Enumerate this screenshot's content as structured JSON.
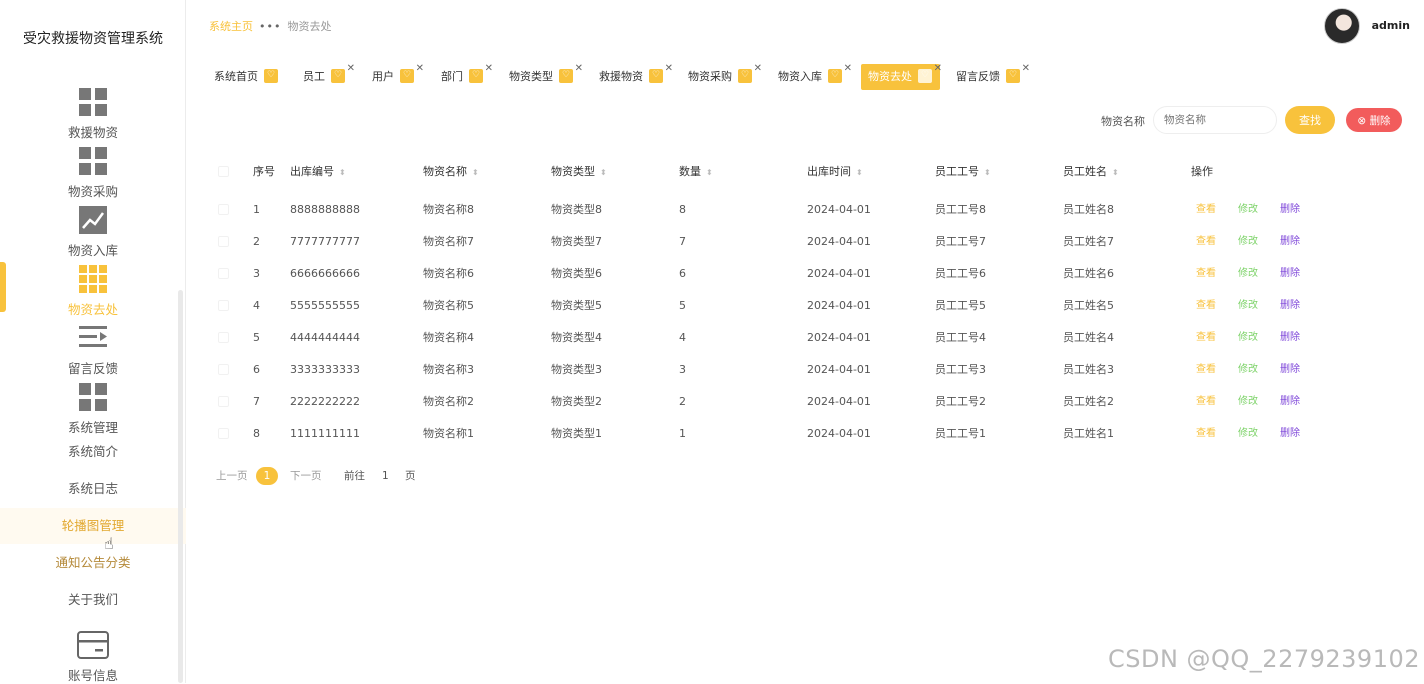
{
  "app": {
    "title": "受灾救援物资管理系统"
  },
  "sidebar": {
    "items": [
      {
        "label": "救援物资",
        "icon": "grid-icon"
      },
      {
        "label": "物资采购",
        "icon": "grid-icon"
      },
      {
        "label": "物资入库",
        "icon": "chart-icon"
      },
      {
        "label": "物资去处",
        "icon": "apps-icon"
      },
      {
        "label": "留言反馈",
        "icon": "list-icon"
      },
      {
        "label": "系统管理",
        "icon": "grid-icon"
      }
    ],
    "sub_items": [
      "系统简介",
      "系统日志",
      "轮播图管理",
      "通知公告分类",
      "关于我们"
    ],
    "account": {
      "label": "账号信息",
      "icon": "card-icon"
    }
  },
  "header": {
    "breadcrumb": {
      "home": "系统主页",
      "current": "物资去处"
    },
    "user": "admin"
  },
  "tabs": [
    "系统首页",
    "员工",
    "用户",
    "部门",
    "物资类型",
    "救援物资",
    "物资采购",
    "物资入库",
    "物资去处",
    "留言反馈"
  ],
  "search": {
    "label": "物资名称",
    "placeholder": "物资名称",
    "search_btn": "查找",
    "delete_btn": "删除"
  },
  "table": {
    "columns": [
      "序号",
      "出库编号",
      "物资名称",
      "物资类型",
      "数量",
      "出库时间",
      "员工工号",
      "员工姓名",
      "操作"
    ],
    "rows": [
      [
        "1",
        "8888888888",
        "物资名称8",
        "物资类型8",
        "8",
        "2024-04-01",
        "员工工号8",
        "员工姓名8"
      ],
      [
        "2",
        "7777777777",
        "物资名称7",
        "物资类型7",
        "7",
        "2024-04-01",
        "员工工号7",
        "员工姓名7"
      ],
      [
        "3",
        "6666666666",
        "物资名称6",
        "物资类型6",
        "6",
        "2024-04-01",
        "员工工号6",
        "员工姓名6"
      ],
      [
        "4",
        "5555555555",
        "物资名称5",
        "物资类型5",
        "5",
        "2024-04-01",
        "员工工号5",
        "员工姓名5"
      ],
      [
        "5",
        "4444444444",
        "物资名称4",
        "物资类型4",
        "4",
        "2024-04-01",
        "员工工号4",
        "员工姓名4"
      ],
      [
        "6",
        "3333333333",
        "物资名称3",
        "物资类型3",
        "3",
        "2024-04-01",
        "员工工号3",
        "员工姓名3"
      ],
      [
        "7",
        "2222222222",
        "物资名称2",
        "物资类型2",
        "2",
        "2024-04-01",
        "员工工号2",
        "员工姓名2"
      ],
      [
        "8",
        "1111111111",
        "物资名称1",
        "物资类型1",
        "1",
        "2024-04-01",
        "员工工号1",
        "员工姓名1"
      ]
    ],
    "actions": {
      "view": "查看",
      "edit": "修改",
      "delete": "删除"
    }
  },
  "pager": {
    "prev": "上一页",
    "current": "1",
    "next": "下一页",
    "goto": "前往",
    "page_input": "1",
    "page_suffix": "页"
  },
  "watermark": "CSDN @QQ_2279239102",
  "colors": {
    "accent": "#f8c23c",
    "danger": "#f25c5c",
    "edit": "#7ed36a",
    "delete_link": "#7e46d9"
  }
}
